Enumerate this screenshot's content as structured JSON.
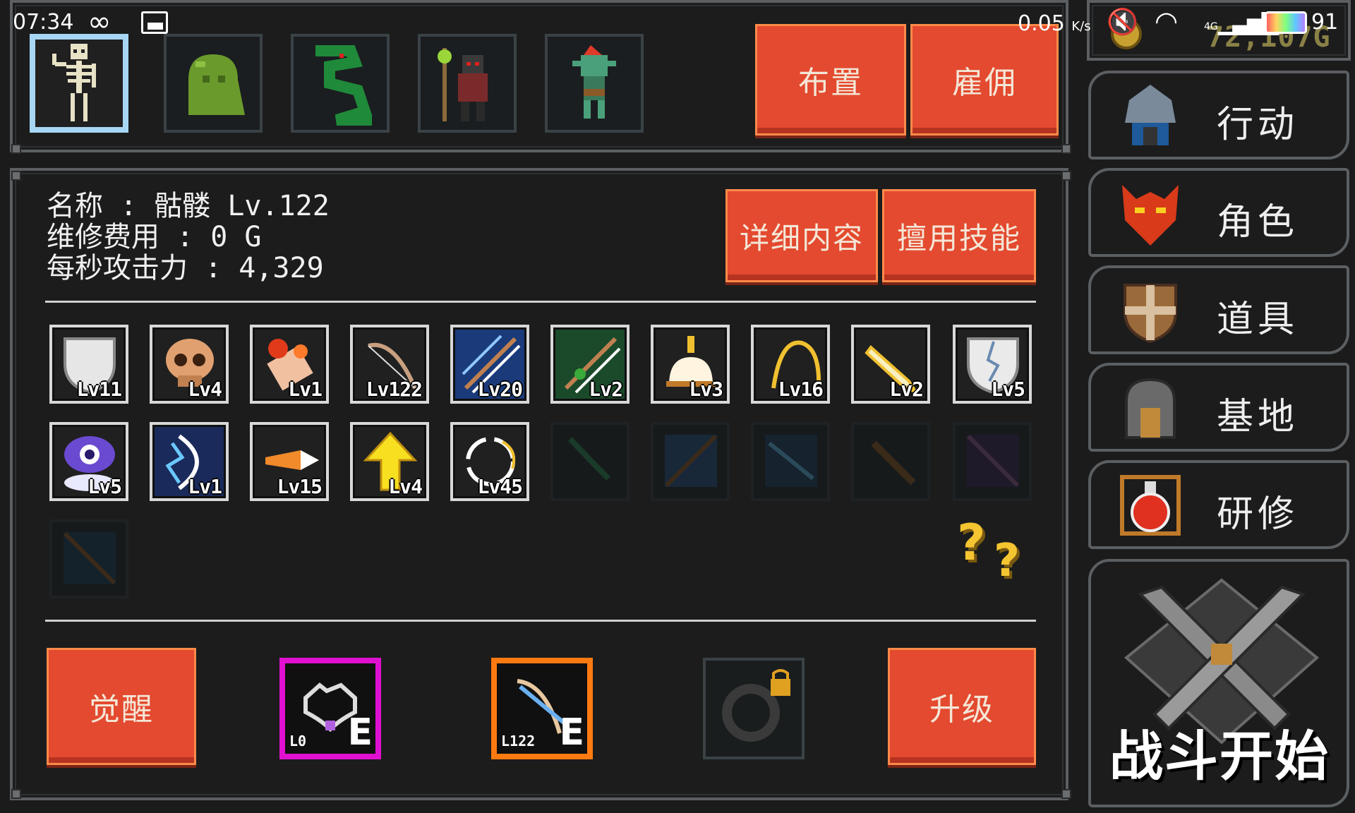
{
  "status_bar": {
    "time": "07:34",
    "speed": "0.05",
    "speed_unit": "K/s",
    "network": "4G",
    "battery": "91"
  },
  "gold": "72,107G",
  "top_buttons": {
    "deploy": "布置",
    "hire": "雇佣"
  },
  "unit": {
    "name_line": "名称 : 骷髅 Lv.122",
    "upkeep_line": "维修费用 : 0 G",
    "dps_line": "每秒攻击力 : 4,329"
  },
  "detail_buttons": {
    "details": "详细内容",
    "skills": "擅用技能"
  },
  "skills": [
    {
      "icon": "shield-icon",
      "level": "Lv11"
    },
    {
      "icon": "skull-icon",
      "level": "Lv4"
    },
    {
      "icon": "fire-fist-icon",
      "level": "Lv1"
    },
    {
      "icon": "bow-icon",
      "level": "Lv122"
    },
    {
      "icon": "ice-arrows-icon",
      "level": "Lv20"
    },
    {
      "icon": "poison-arrows-icon",
      "level": "Lv2"
    },
    {
      "icon": "bell-icon",
      "level": "Lv3"
    },
    {
      "icon": "golden-bow-icon",
      "level": "Lv16"
    },
    {
      "icon": "golden-blade-icon",
      "level": "Lv2"
    },
    {
      "icon": "cracked-shield-icon",
      "level": "Lv5"
    },
    {
      "icon": "eye-icon",
      "level": "Lv5"
    },
    {
      "icon": "lightning-bow-icon",
      "level": "Lv1"
    },
    {
      "icon": "fire-arrow-icon",
      "level": "Lv15"
    },
    {
      "icon": "up-arrow-icon",
      "level": "Lv4"
    },
    {
      "icon": "ring-icon",
      "level": "Lv45"
    }
  ],
  "locked_skills": [
    "vine-icon",
    "crossbow-icon",
    "ice-shards-icon",
    "club-icon",
    "dark-crossbow-icon",
    "dark-arrows-icon"
  ],
  "bottom": {
    "awaken": "觉醒",
    "upgrade": "升级",
    "equip_1": {
      "level": "L0",
      "grade": "E",
      "frame": "#e010d0"
    },
    "equip_2": {
      "level": "L122",
      "grade": "E",
      "frame": "#ff7a10"
    }
  },
  "menu": [
    {
      "icon": "helmet-icon",
      "label": "行动"
    },
    {
      "icon": "demon-mask-icon",
      "label": "角色"
    },
    {
      "icon": "shield-item-icon",
      "label": "道具"
    },
    {
      "icon": "base-gate-icon",
      "label": "基地"
    },
    {
      "icon": "potion-icon",
      "label": "研修"
    }
  ],
  "battle_label": "战斗开始",
  "colors": {
    "accent_red": "#e34a2f",
    "selected_border": "#a7d6f5"
  }
}
